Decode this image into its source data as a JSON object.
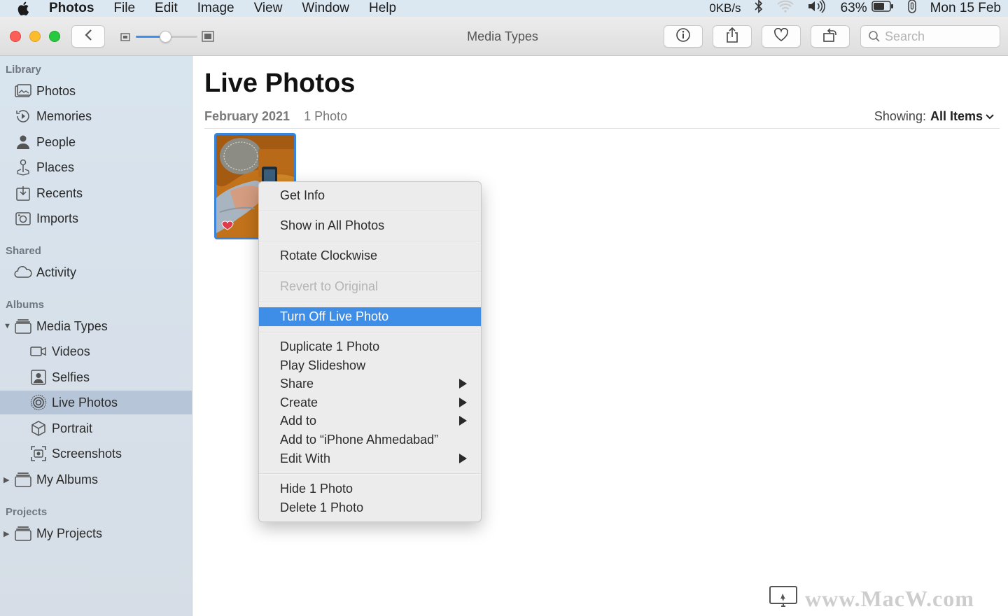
{
  "menubar": {
    "app_name": "Photos",
    "items": [
      "File",
      "Edit",
      "Image",
      "View",
      "Window",
      "Help"
    ],
    "net_speed": "0KB/s",
    "battery": "63%",
    "clock": "Mon 15 Feb"
  },
  "toolbar": {
    "title": "Media Types",
    "search_placeholder": "Search"
  },
  "sidebar": {
    "library_header": "Library",
    "library": [
      "Photos",
      "Memories",
      "People",
      "Places",
      "Recents",
      "Imports"
    ],
    "shared_header": "Shared",
    "shared": [
      "Activity"
    ],
    "albums_header": "Albums",
    "media_types": "Media Types",
    "media_children": [
      "Videos",
      "Selfies",
      "Live Photos",
      "Portrait",
      "Screenshots"
    ],
    "my_albums": "My Albums",
    "projects_header": "Projects",
    "my_projects": "My Projects",
    "selected": "Live Photos"
  },
  "content": {
    "title": "Live Photos",
    "date": "February 2021",
    "count": "1 Photo",
    "showing_label": "Showing:",
    "showing_value": "All Items"
  },
  "context_menu": {
    "items": [
      "Get Info",
      "Show in All Photos",
      "Rotate Clockwise",
      "Revert to Original",
      "Turn Off Live Photo",
      "Duplicate 1 Photo",
      "Play Slideshow",
      "Share",
      "Create",
      "Add to",
      "Add to “iPhone Ahmedabad”",
      "Edit With",
      "Hide 1 Photo",
      "Delete 1 Photo"
    ],
    "highlighted": "Turn Off Live Photo",
    "disabled": "Revert to Original"
  },
  "watermark": "www.MacW.com",
  "colors": {
    "accent": "#3e8de6",
    "selection": "#b6c6d8",
    "sidebar": "#d8e4ee"
  }
}
